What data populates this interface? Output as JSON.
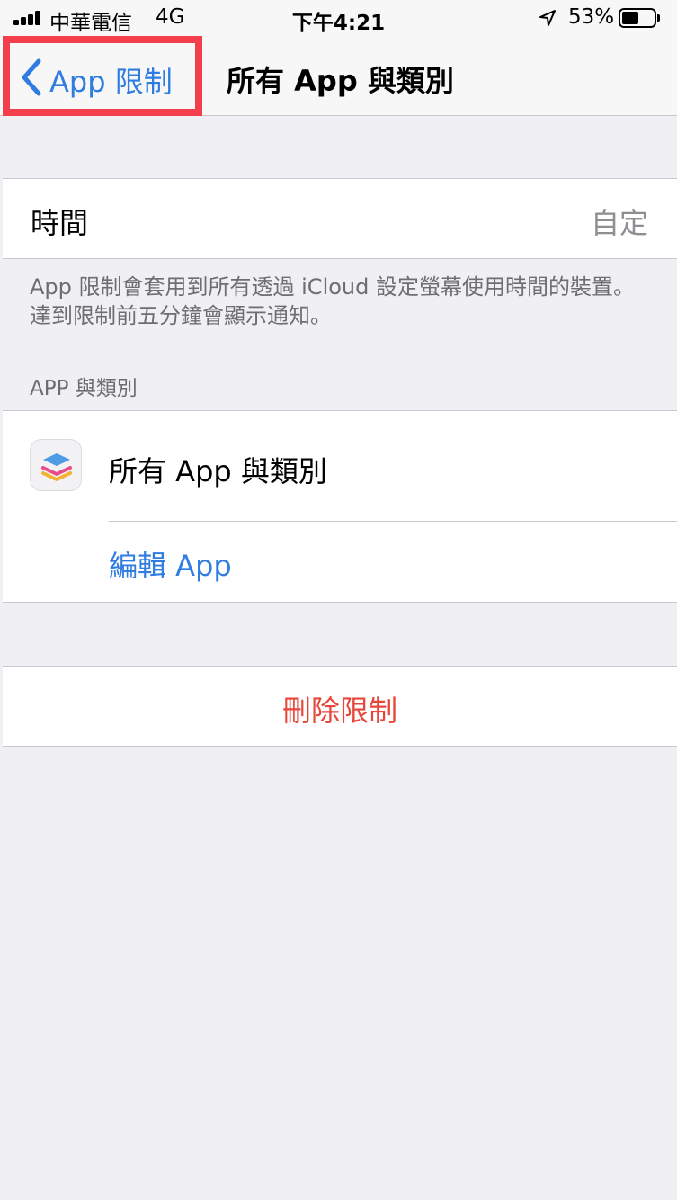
{
  "status_bar": {
    "carrier": "中華電信",
    "network": "4G",
    "time": "下午4:21",
    "battery_percent": "53%",
    "battery_level": 0.53,
    "location_icon": "location-arrow-icon"
  },
  "nav": {
    "back_label": "App 限制",
    "back_icon": "chevron-left-icon",
    "title": "所有 App 與類別"
  },
  "time_cell": {
    "label": "時間",
    "value": "自定"
  },
  "footnote": "App 限制會套用到所有透過 iCloud 設定螢幕使用時間的裝置。達到限制前五分鐘會顯示通知。",
  "apps_section": {
    "header": "APP 與類別",
    "app_row": {
      "icon": "stacked-layers-icon",
      "label": "所有 App 與類別"
    },
    "edit_label": "編輯 App"
  },
  "delete_label": "刪除限制",
  "colors": {
    "accent": "#2f7de1",
    "destructive": "#e8463a",
    "highlight_box": "#f33f4b",
    "background": "#efeff4"
  }
}
